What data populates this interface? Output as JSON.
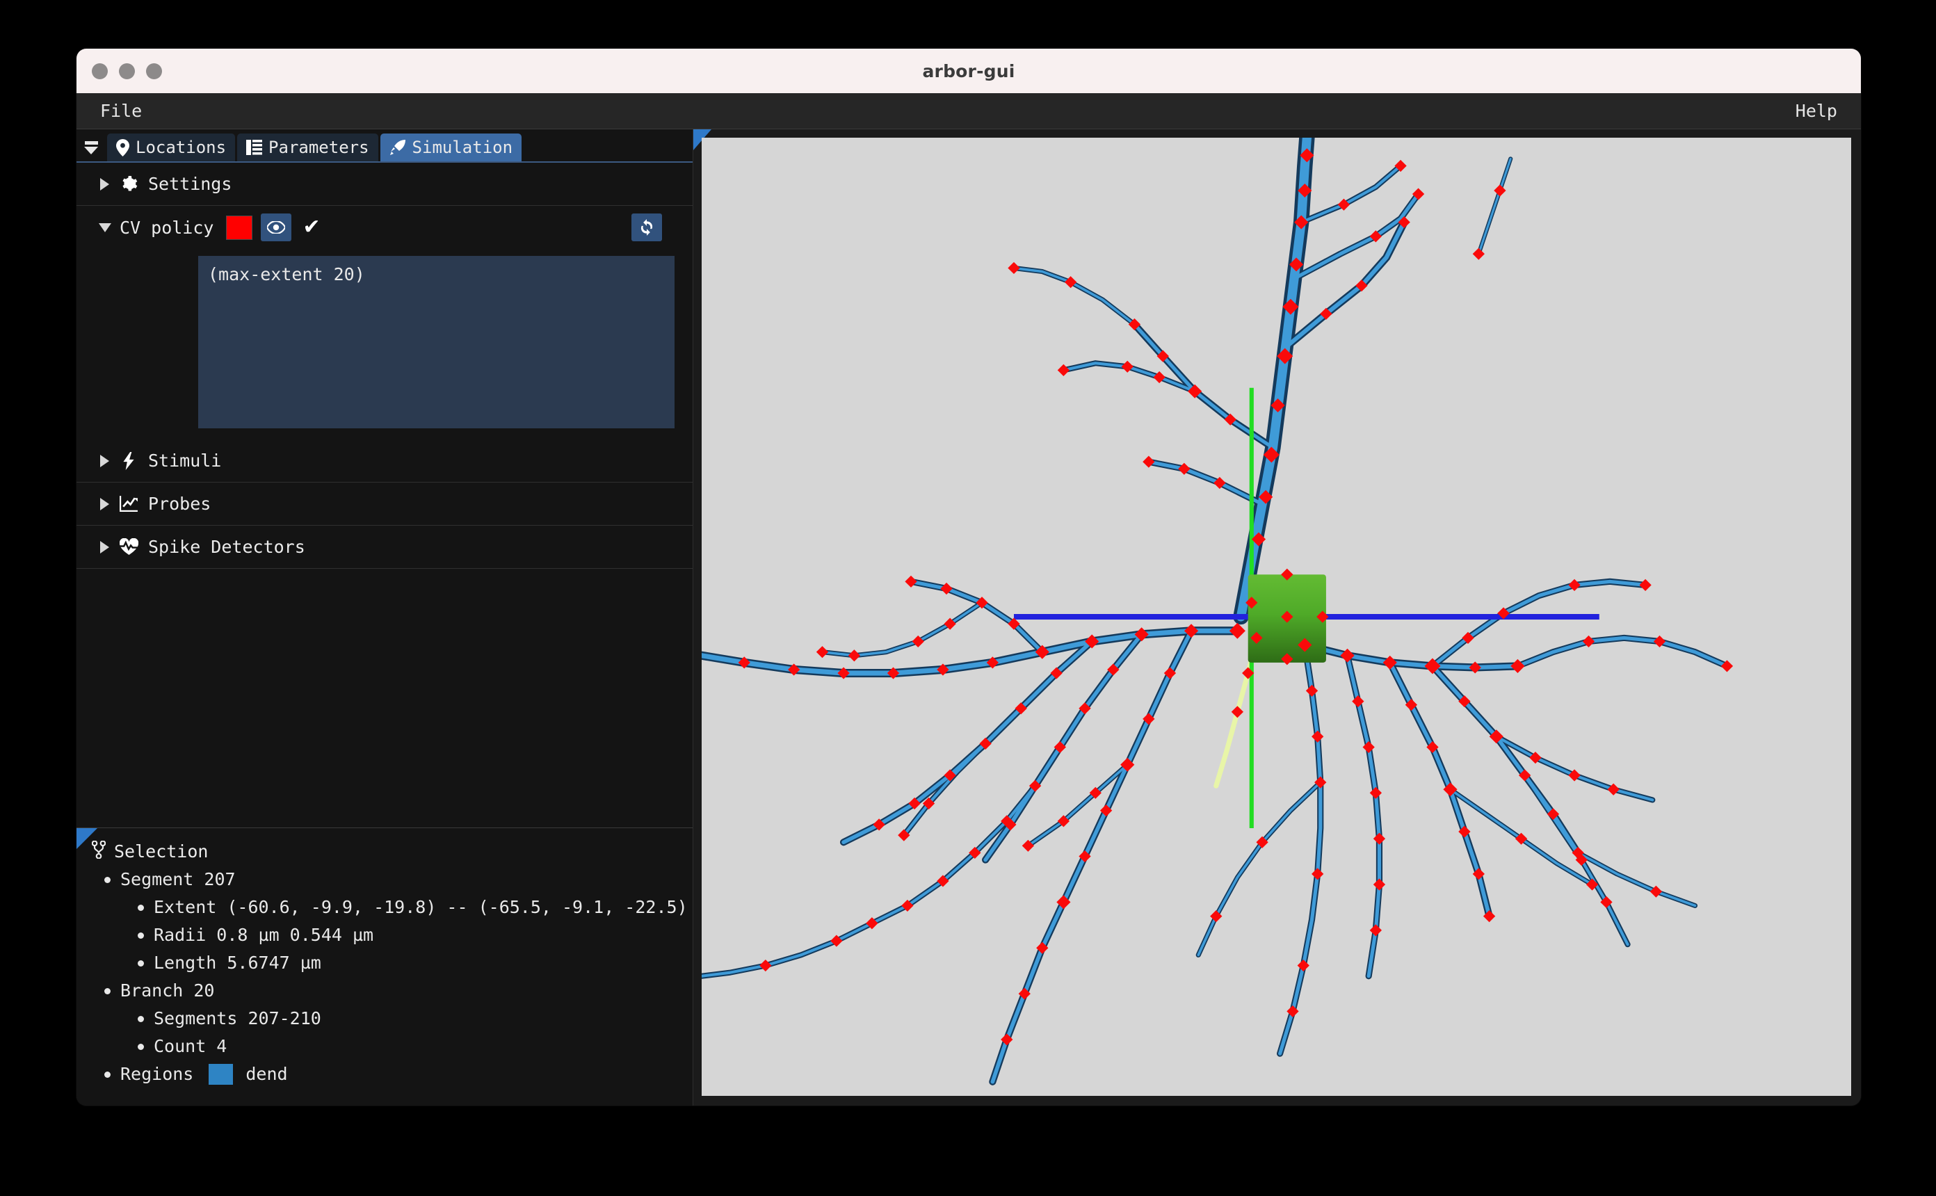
{
  "window": {
    "title": "arbor-gui",
    "traffic_lights": [
      "close",
      "minimize",
      "zoom"
    ]
  },
  "menubar": {
    "file_label": "File",
    "help_label": "Help"
  },
  "tabs": [
    {
      "label": "Locations",
      "icon": "map-pin-icon",
      "active": false
    },
    {
      "label": "Parameters",
      "icon": "list-icon",
      "active": false
    },
    {
      "label": "Simulation",
      "icon": "rocket-icon",
      "active": true
    }
  ],
  "sidebar": {
    "sections": [
      {
        "label": "Settings",
        "icon": "gear-icon",
        "expanded": false
      },
      {
        "label": "CV policy",
        "icon": "none",
        "expanded": true
      },
      {
        "label": "Stimuli",
        "icon": "bolt-icon",
        "expanded": false
      },
      {
        "label": "Probes",
        "icon": "chart-icon",
        "expanded": false
      },
      {
        "label": "Spike Detectors",
        "icon": "heartbeat-icon",
        "expanded": false
      }
    ],
    "cv_policy": {
      "label": "CV policy",
      "color": "#ff0000",
      "visibility_icon": "eye-icon",
      "confirm_icon": "check-icon",
      "refresh_icon": "refresh-icon",
      "editor_text": "(max-extent 20)"
    }
  },
  "selection": {
    "title": "Selection",
    "icon": "code-branch-icon",
    "segment_label": "Segment 207",
    "segment_details": [
      "Extent (-60.6, -9.9, -19.8) -- (-65.5, -9.1, -22.5)",
      "Radii  0.8 µm 0.544 µm",
      "Length 5.6747 µm"
    ],
    "branch_label": "Branch 20",
    "branch_details": [
      "Segments 207-210",
      "Count 4"
    ],
    "regions_label": "Regions",
    "region_color": "#2e84c4",
    "region_name": "dend"
  },
  "viewport": {
    "background": "#d6d6d6",
    "soma_color": "#4faa28",
    "dendrite_color": "#2d7fbf",
    "marker_color": "#fa0a0a",
    "axis_x_color": "#2222dd",
    "axis_y_color": "#22dd22",
    "highlight_color": "#e8f5a8",
    "marker_count": 160
  }
}
